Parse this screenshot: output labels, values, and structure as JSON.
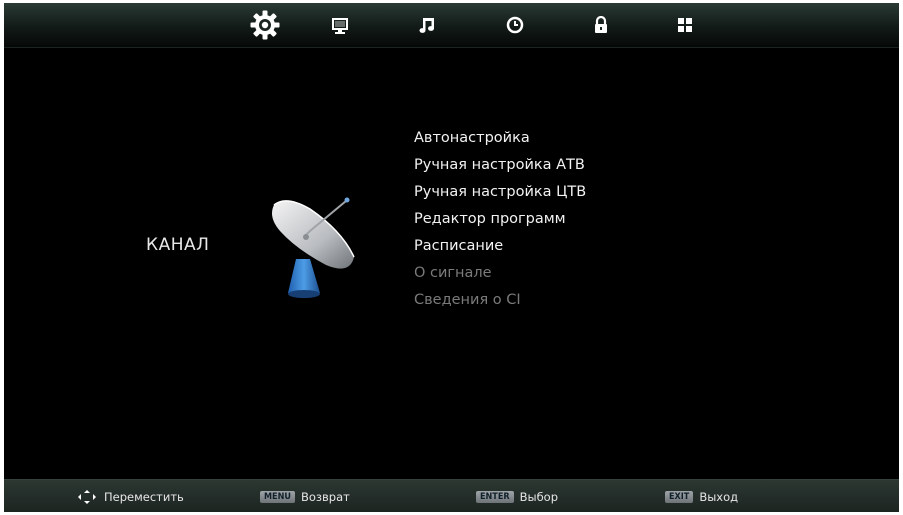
{
  "top_tabs": [
    {
      "name": "gear-icon",
      "label": "Channel"
    },
    {
      "name": "picture-icon",
      "label": "Picture"
    },
    {
      "name": "sound-icon",
      "label": "Sound"
    },
    {
      "name": "clock-icon",
      "label": "Time"
    },
    {
      "name": "lock-icon",
      "label": "Lock"
    },
    {
      "name": "setup-icon",
      "label": "Setup"
    }
  ],
  "category": {
    "label": "КАНАЛ",
    "icon": "satellite-dish-icon"
  },
  "menu": {
    "items": [
      {
        "label": "Автонастройка",
        "enabled": true
      },
      {
        "label": "Ручная настройка АТВ",
        "enabled": true
      },
      {
        "label": "Ручная настройка ЦТВ",
        "enabled": true
      },
      {
        "label": "Редактор программ",
        "enabled": true
      },
      {
        "label": "Расписание",
        "enabled": true
      },
      {
        "label": "О сигнале",
        "enabled": false
      },
      {
        "label": "Сведения о CI",
        "enabled": false
      }
    ]
  },
  "footer": {
    "move": {
      "label": "Переместить",
      "icon": "arrows-icon"
    },
    "menu": {
      "key": "MENU",
      "label": "Возврат"
    },
    "enter": {
      "key": "ENTER",
      "label": "Выбор"
    },
    "exit": {
      "key": "EXIT",
      "label": "Выход"
    }
  },
  "colors": {
    "background": "#000000",
    "text": "#f2f2f2",
    "disabled_text": "#7a7a7a",
    "bar": "#24302b"
  }
}
